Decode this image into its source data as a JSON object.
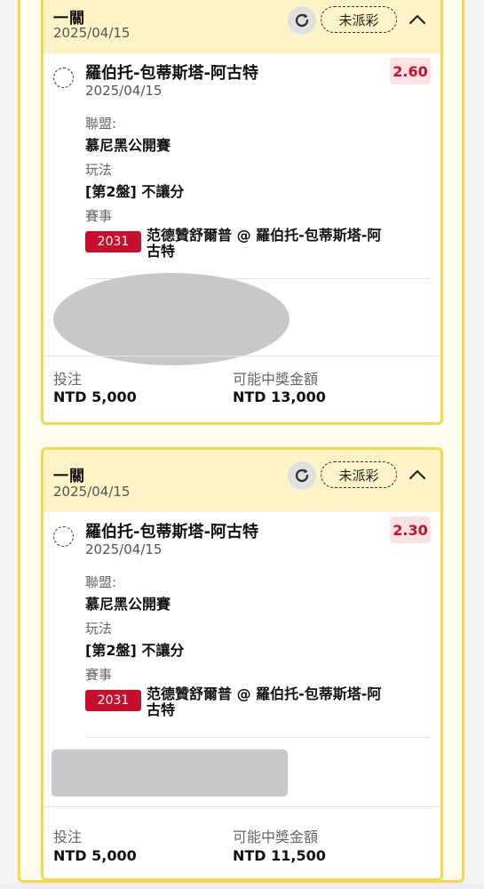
{
  "bets": [
    {
      "bet_type": "一關",
      "bet_date": "2025/04/15",
      "status": "未派彩",
      "selection": {
        "team": "羅伯托-包蒂斯塔-阿古特",
        "date": "2025/04/15",
        "odds": "2.60",
        "league_label": "聯盟:",
        "league": "慕尼黑公開賽",
        "market_label": "玩法",
        "market": "[第2盤] 不讓分",
        "event_label": "賽事",
        "match_id": "2031",
        "match": "范德贊舒爾普 @ 羅伯托-包蒂斯塔-阿古特"
      },
      "stake_label": "投注",
      "stake": "NTD 5,000",
      "payout_label": "可能中獎金額",
      "payout": "NTD 13,000"
    },
    {
      "bet_type": "一關",
      "bet_date": "2025/04/15",
      "status": "未派彩",
      "selection": {
        "team": "羅伯托-包蒂斯塔-阿古特",
        "date": "2025/04/15",
        "odds": "2.30",
        "league_label": "聯盟:",
        "league": "慕尼黑公開賽",
        "market_label": "玩法",
        "market": "[第2盤] 不讓分",
        "event_label": "賽事",
        "match_id": "2031",
        "match": "范德贊舒爾普 @ 羅伯托-包蒂斯塔-阿古特"
      },
      "stake_label": "投注",
      "stake": "NTD 5,000",
      "payout_label": "可能中獎金額",
      "payout": "NTD 11,500"
    }
  ],
  "colors": {
    "accent_border": "#f5d94a",
    "header_bg": "#fdf3c6",
    "odds_text": "#c8102e",
    "match_badge": "#c8102e"
  },
  "icons": {
    "refresh": "refresh-icon",
    "collapse": "chevron-up-icon",
    "select": "selection-circle-icon"
  }
}
